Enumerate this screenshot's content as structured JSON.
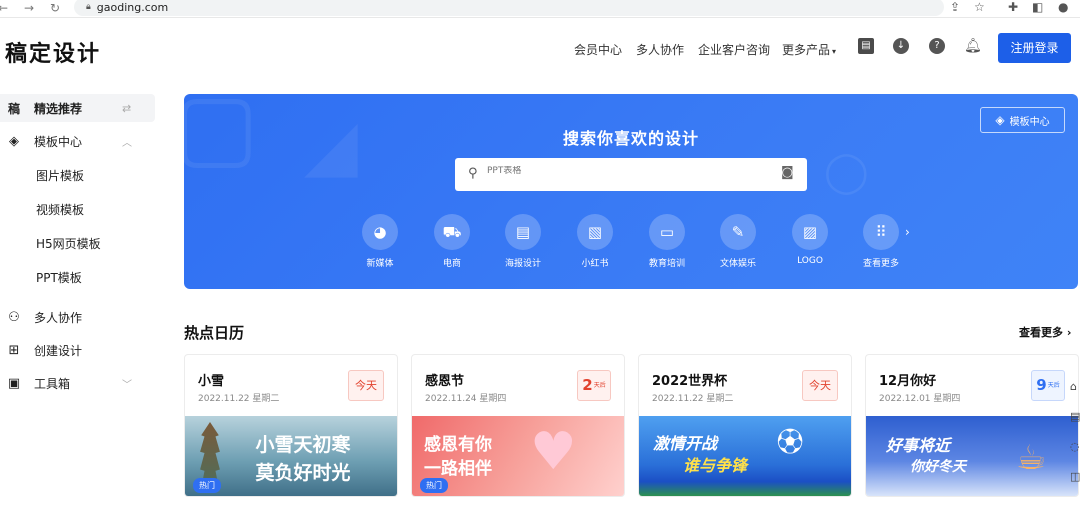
{
  "browser": {
    "url": "gaoding.com"
  },
  "header": {
    "logo": "稿定设计",
    "nav": [
      "会员中心",
      "多人协作",
      "企业客户咨询",
      "更多产品"
    ],
    "register_label": "注册登录"
  },
  "sidebar": {
    "items": [
      {
        "icon": "gaoding-logo-icon",
        "label": "精选推荐"
      },
      {
        "icon": "layers-icon",
        "label": "模板中心"
      },
      {
        "label": "图片模板"
      },
      {
        "label": "视频模板"
      },
      {
        "label": "H5网页模板"
      },
      {
        "label": "PPT模板"
      },
      {
        "icon": "people-icon",
        "label": "多人协作"
      },
      {
        "icon": "add-square-icon",
        "label": "创建设计"
      },
      {
        "icon": "toolbox-icon",
        "label": "工具箱"
      }
    ]
  },
  "banner": {
    "title": "搜索你喜欢的设计",
    "template_center_label": "模板中心",
    "search_placeholder": "PPT表格",
    "categories": [
      {
        "icon": "new-media-icon",
        "label": "新媒体"
      },
      {
        "icon": "cart-icon",
        "label": "电商"
      },
      {
        "icon": "poster-icon",
        "label": "海报设计"
      },
      {
        "icon": "xiaohongshu-icon",
        "label": "小红书"
      },
      {
        "icon": "training-icon",
        "label": "教育培训"
      },
      {
        "icon": "entertainment-icon",
        "label": "文体娱乐"
      },
      {
        "icon": "logo-design-icon",
        "label": "LOGO"
      },
      {
        "icon": "grid-icon",
        "label": "查看更多"
      }
    ]
  },
  "hot_calendar": {
    "title": "热点日历",
    "see_more_label": "查看更多",
    "cards": [
      {
        "title": "小雪",
        "date": "2022.11.22  星期二",
        "badge": "今天",
        "badge_type": "today",
        "image_text": [
          "小雪天初寒",
          "莫负好时光"
        ],
        "hot_tag": "热门",
        "colors": [
          "#3d6d86",
          "#b7d2dc"
        ]
      },
      {
        "title": "感恩节",
        "date": "2022.11.24  星期四",
        "badge": "2",
        "badge_unit": "天后",
        "badge_type": "days",
        "image_text": [
          "感恩有你",
          "一路相伴"
        ],
        "hot_tag": "热门",
        "colors": [
          "#f06a6a",
          "#ffd2cf"
        ]
      },
      {
        "title": "2022世界杯",
        "date": "2022.11.22  星期二",
        "badge": "今天",
        "badge_type": "today",
        "image_text": [
          "激情开战",
          "谁与争锋"
        ],
        "hot_tag": "",
        "colors": [
          "#1b4fc5",
          "#4fa0f0"
        ]
      },
      {
        "title": "12月你好",
        "date": "2022.12.01  星期四",
        "badge": "9",
        "badge_unit": "天后",
        "badge_type": "days-blue",
        "image_text": [
          "好事将近",
          "你好冬天"
        ],
        "hot_tag": "",
        "colors": [
          "#2e5fd0",
          "#a9c4f5"
        ]
      }
    ]
  }
}
